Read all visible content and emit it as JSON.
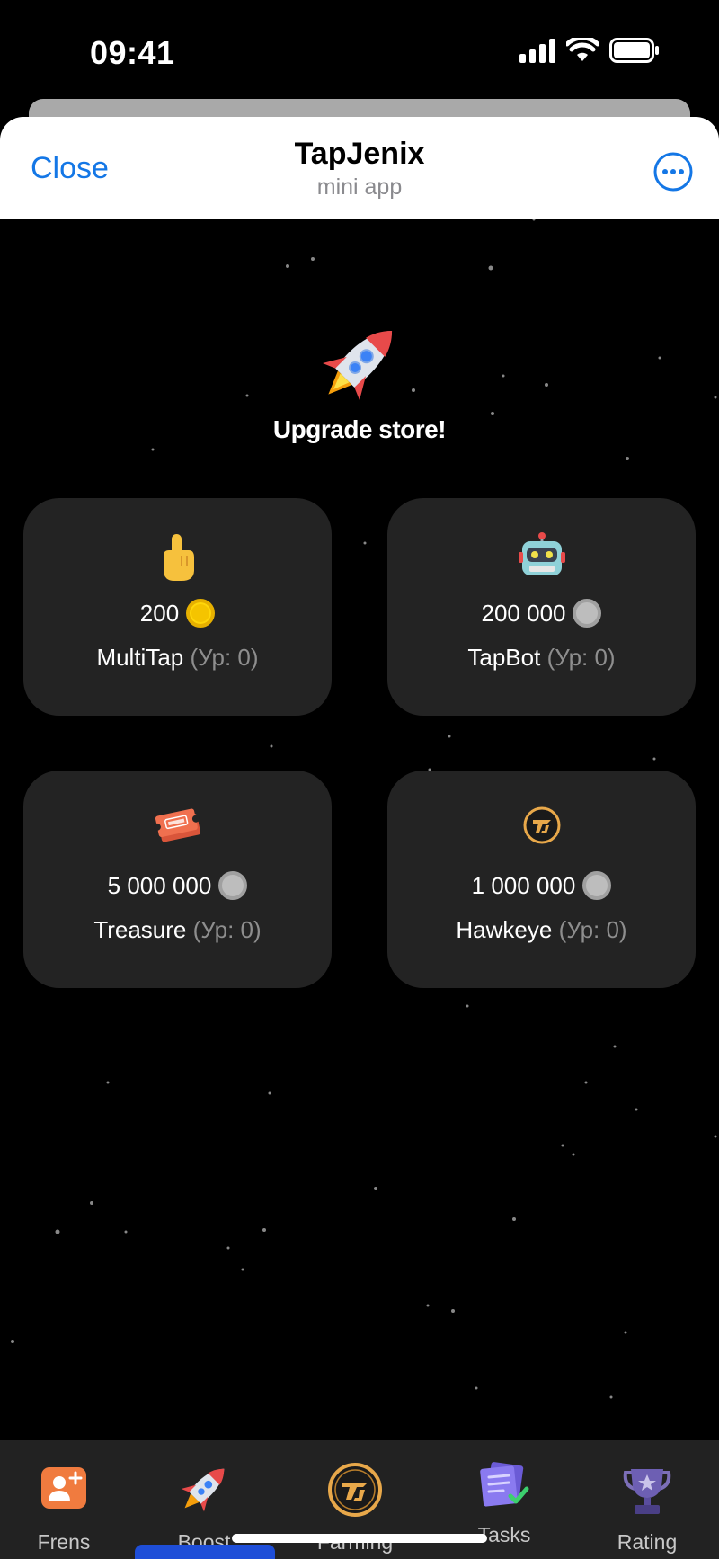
{
  "status_bar": {
    "time": "09:41"
  },
  "header": {
    "close_label": "Close",
    "title": "TapJenix",
    "subtitle": "mini app"
  },
  "hero": {
    "title": "Upgrade store!"
  },
  "cards": [
    {
      "icon": "pointing-finger-icon",
      "price": "200",
      "coin": "gold",
      "name": "MultiTap",
      "level": "(Ур: 0)"
    },
    {
      "icon": "robot-icon",
      "price": "200 000",
      "coin": "silver",
      "name": "TapBot",
      "level": "(Ур: 0)"
    },
    {
      "icon": "ticket-icon",
      "price": "5 000 000",
      "coin": "silver",
      "name": "Treasure",
      "level": "(Ур: 0)"
    },
    {
      "icon": "tj-logo-icon",
      "price": "1 000 000",
      "coin": "silver",
      "name": "Hawkeye",
      "level": "(Ур: 0)"
    }
  ],
  "nav": {
    "items": [
      {
        "label": "Frens",
        "icon": "add-friend-icon"
      },
      {
        "label": "Boost",
        "icon": "rocket-icon",
        "active": true
      },
      {
        "label": "Farming",
        "icon": "tj-coin-icon"
      },
      {
        "label": "Tasks",
        "icon": "tasks-icon"
      },
      {
        "label": "Rating",
        "icon": "trophy-icon"
      }
    ]
  },
  "colors": {
    "accent": "#1477e6",
    "card_bg": "#232323",
    "nav_bg": "#222222",
    "active_indicator": "#1e4ed8",
    "gold_coin": "#f5c400",
    "silver_coin": "#bdbdbd"
  }
}
